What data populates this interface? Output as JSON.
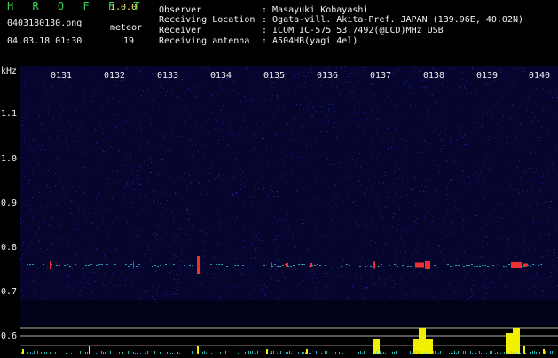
{
  "header": {
    "app_name": "H R O F F T",
    "version": "1.0.0",
    "filename": "0403180130.png",
    "detection_label": "meteor",
    "datetime": "04.03.18 01:30",
    "meteor_count": "19",
    "observer_label": "Observer",
    "observer_value": ": Masayuki Kobayashi",
    "location_label": "Receiving Location",
    "location_value": ": Ogata-vill. Akita-Pref. JAPAN (139.96E, 40.02N)",
    "receiver_label": "Receiver",
    "receiver_value": ": ICOM IC-575 53.7492(@LCD)MHz USB",
    "antenna_label": "Receiving antenna",
    "antenna_value": ": A504HB(yagi 4el)"
  },
  "spectrogram": {
    "unit": "kHz",
    "freq_ticks": [
      "1.1",
      "1.0",
      "0.9",
      "0.8",
      "0.7",
      "0.6"
    ],
    "time_ticks": [
      "0131",
      "0132",
      "0133",
      "0134",
      "0135",
      "0136",
      "0137",
      "0138",
      "0139",
      "0140"
    ],
    "colors": {
      "background": "#05052e",
      "noise": "#2a2aa8",
      "echo": "#ff3030",
      "level": "#f0f000",
      "cyan": "#30e0e0"
    }
  }
}
